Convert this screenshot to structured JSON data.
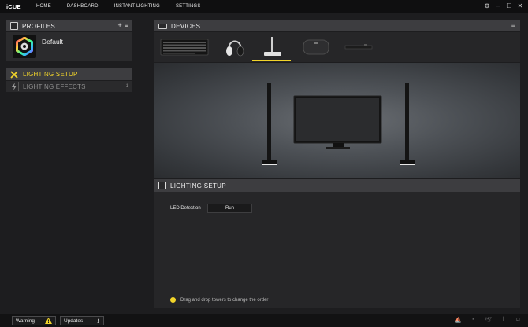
{
  "app": {
    "title": "iCUE"
  },
  "nav": {
    "items": [
      "HOME",
      "DASHBOARD",
      "INSTANT LIGHTING",
      "SETTINGS"
    ]
  },
  "window_controls": {
    "settings": "⚙",
    "minimize": "–",
    "maximize": "☐",
    "close": "✕"
  },
  "profiles": {
    "title": "PROFILES",
    "add_symbol": "+",
    "menu_symbol": "≡",
    "items": [
      {
        "name": "Default"
      }
    ]
  },
  "left_menu": {
    "lighting_setup": "LIGHTING SETUP",
    "lighting_effects": "LIGHTING EFFECTS",
    "lighting_effects_count": "1"
  },
  "devices": {
    "title": "DEVICES",
    "items": [
      "keyboard-device",
      "headset-device",
      "lighting-node-device",
      "mousepad-device",
      "sensor-bar-device"
    ],
    "selected_index": 2
  },
  "setup": {
    "title": "LIGHTING SETUP",
    "led_detection_label": "LED Detection",
    "run_button": "Run",
    "hint_icon": "!",
    "hint_text": "Drag and drop towers to change the order"
  },
  "footer": {
    "warning_label": "Warning",
    "updates_label": "Updates",
    "social_icons": [
      "corsair-icon",
      "chat-icon",
      "twitter-icon",
      "facebook-icon",
      "instagram-icon"
    ]
  },
  "colors": {
    "accent": "#f2d42a",
    "panel_header": "#3d3d40",
    "background": "#1d1d1f"
  }
}
